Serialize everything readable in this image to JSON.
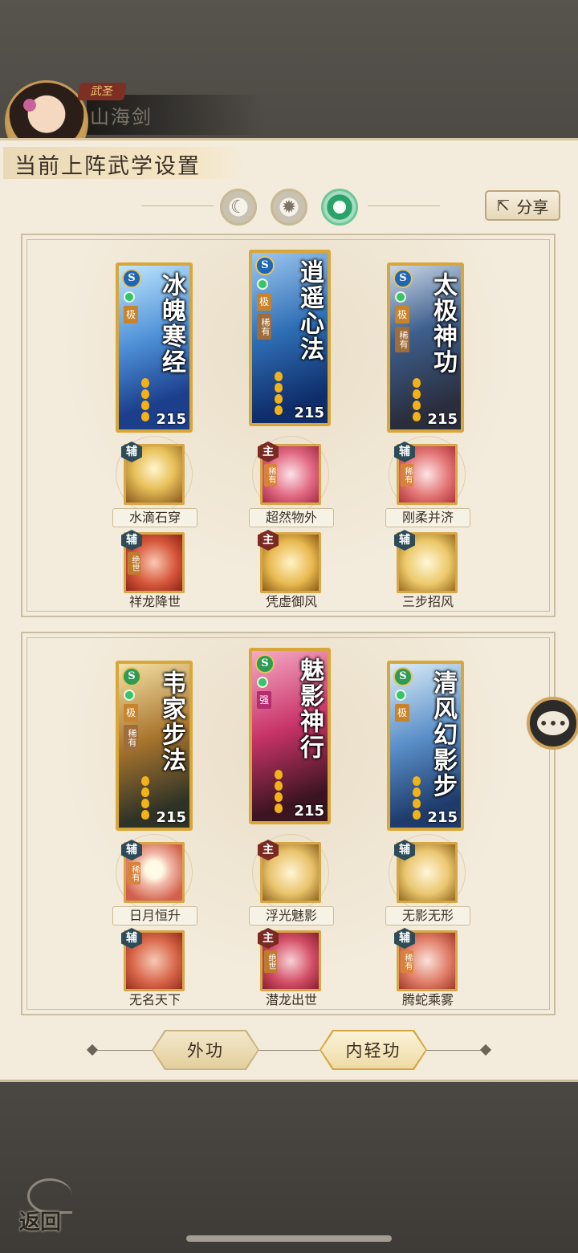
{
  "player": {
    "title_badge": "武圣",
    "name": "山海剑"
  },
  "panel": {
    "title": "当前上阵武学设置",
    "share_label": "分享"
  },
  "mode_icons": [
    "moon-icon",
    "sun-icon",
    "jade-icon"
  ],
  "group1": {
    "cards": [
      {
        "name": "冰魄寒经",
        "school": "S",
        "tags": [
          "极"
        ],
        "level": "215"
      },
      {
        "name": "逍遥心法",
        "school": "S",
        "tags": [
          "极",
          "稀有"
        ],
        "level": "215"
      },
      {
        "name": "太极神功",
        "school": "S",
        "tags": [
          "极",
          "稀有"
        ],
        "level": "215"
      }
    ],
    "skills_row1": [
      {
        "badge": "辅",
        "name": "水滴石穿"
      },
      {
        "badge": "主",
        "rare": "稀有",
        "name": "超然物外"
      },
      {
        "badge": "辅",
        "rare": "稀有",
        "name": "刚柔并济"
      }
    ],
    "skills_row2": [
      {
        "badge": "辅",
        "rare": "绝世",
        "name": "祥龙降世"
      },
      {
        "badge": "主",
        "name": "凭虚御风"
      },
      {
        "badge": "辅",
        "name": "三步招风"
      }
    ]
  },
  "group2": {
    "cards": [
      {
        "name": "韦家步法",
        "school": "S",
        "tags": [
          "极",
          "稀有"
        ],
        "level": "215"
      },
      {
        "name": "魅影神行",
        "school": "S",
        "tags": [
          "强"
        ],
        "level": "215"
      },
      {
        "name": "清风幻影步",
        "school": "S",
        "tags": [
          "极"
        ],
        "level": "215"
      }
    ],
    "skills_row1": [
      {
        "badge": "辅",
        "rare": "稀有",
        "name": "日月恒升"
      },
      {
        "badge": "主",
        "name": "浮光魅影"
      },
      {
        "badge": "辅",
        "name": "无影无形"
      }
    ],
    "skills_row2": [
      {
        "badge": "辅",
        "name": "无名天下"
      },
      {
        "badge": "主",
        "rare": "绝世",
        "name": "潜龙出世"
      },
      {
        "badge": "辅",
        "rare": "稀有",
        "name": "腾蛇乘雾"
      }
    ]
  },
  "tabs": {
    "external": "外功",
    "internal": "内轻功",
    "active": "internal"
  },
  "back_label": "返回",
  "colors": {
    "panel_bg": "#f3ebdb",
    "card_border": "#d8a739",
    "active_mode": "#29a36a"
  }
}
